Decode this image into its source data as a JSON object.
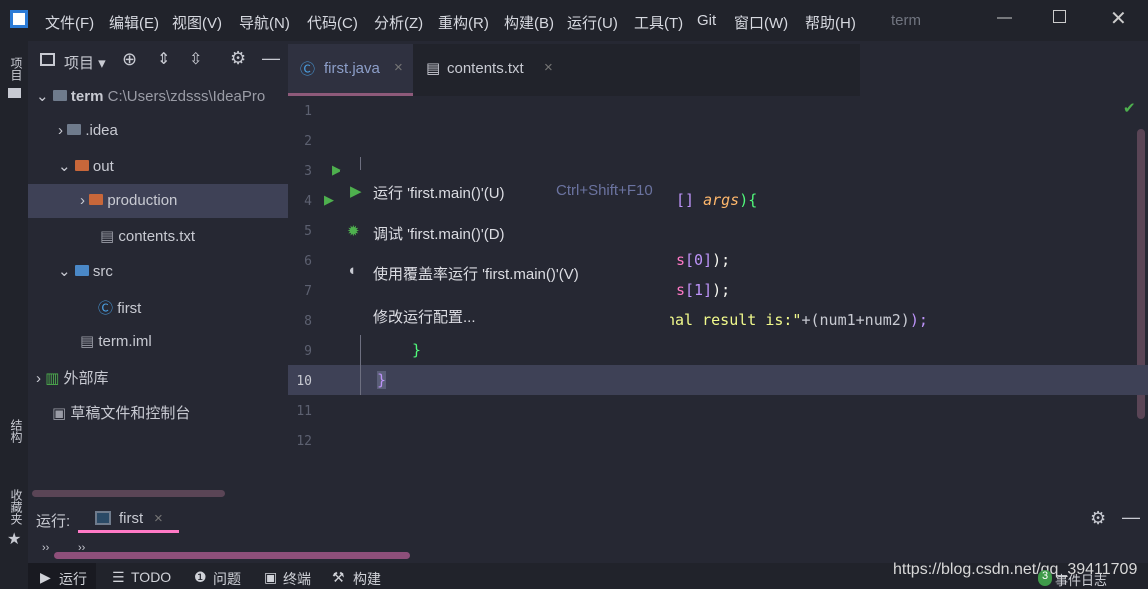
{
  "titlebar": {
    "menus": [
      "文件(F)",
      "编辑(E)",
      "视图(V)",
      "导航(N)",
      "代码(C)",
      "分析(Z)",
      "重构(R)",
      "构建(B)",
      "运行(U)",
      "工具(T)",
      "Git",
      "窗口(W)",
      "帮助(H)"
    ],
    "project_name": "term"
  },
  "left_strip": {
    "project": "项目",
    "structure": "结构",
    "favorites": "收藏夹"
  },
  "project_panel": {
    "title": "项目",
    "root_name": "term",
    "root_path": "C:\\Users\\zdsss\\IdeaPro",
    "items": [
      ".idea",
      "out",
      "production",
      "contents.txt",
      "src",
      "first",
      "term.iml",
      "外部库",
      "草稿文件和控制台"
    ]
  },
  "editor": {
    "tabs": [
      {
        "label": "first.java",
        "active": true
      },
      {
        "label": "contents.txt",
        "active": false
      }
    ],
    "line_numbers": [
      "1",
      "2",
      "3",
      "4",
      "5",
      "6",
      "7",
      "8",
      "9",
      "10",
      "11",
      "12"
    ],
    "fragments": {
      "l4_a": "[] ",
      "l4_b": "args",
      "l4_c": "){",
      "l6_a": "s",
      "l6_b": "[0]",
      "l6_c": ");",
      "l7_a": "s",
      "l7_b": "[1]",
      "l7_c": ");",
      "l8_a": "nal result is:\"",
      "l8_b": "+(num1+num2)",
      "l8_c": ");",
      "l9": "}",
      "l10": "}"
    }
  },
  "popup": {
    "items": [
      {
        "label": "运行 'first.main()'(U)",
        "shortcut": "Ctrl+Shift+F10"
      },
      {
        "label": "调试 'first.main()'(D)"
      },
      {
        "label": "使用覆盖率运行  'first.main()'(V)"
      },
      {
        "label": "修改运行配置..."
      }
    ]
  },
  "run_panel": {
    "label": "运行:",
    "tab": "first"
  },
  "statusbar": {
    "items": [
      "运行",
      "TODO",
      "问题",
      "终端",
      "构建"
    ],
    "watermark": "https://blog.csdn.net/qq_39411709",
    "event_count": "3",
    "event_log": "事件日志"
  },
  "colors": {
    "accent": "#ff79c6",
    "bg": "#262833",
    "run_green": "#4eb04e"
  }
}
